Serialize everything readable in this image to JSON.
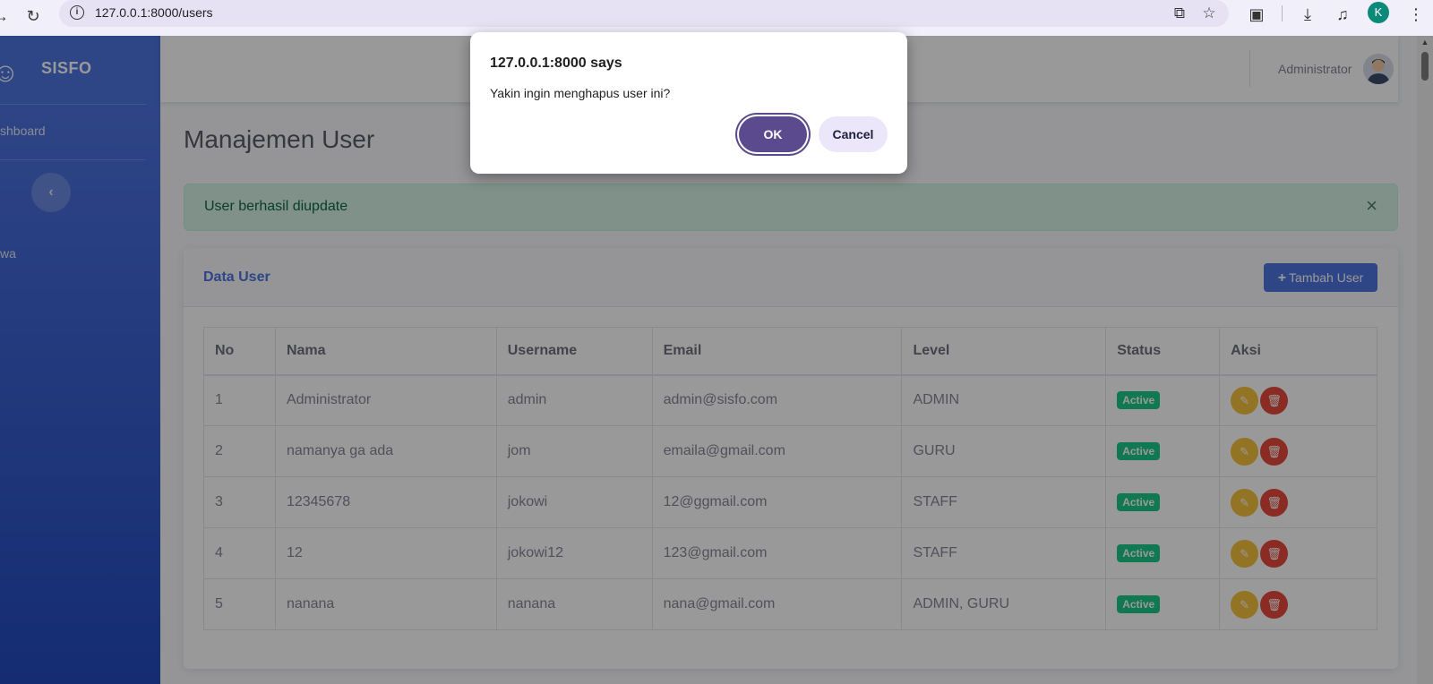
{
  "browser": {
    "url": "127.0.0.1:8000/users",
    "profile_initial": "K"
  },
  "sidebar": {
    "brand": "SISFO",
    "items": [
      {
        "label": "shboard"
      },
      {
        "label": "wa"
      }
    ]
  },
  "topbar": {
    "user_name": "Administrator"
  },
  "main": {
    "page_title": "Manajemen User",
    "alert_message": "User berhasil diupdate",
    "alert_close": "×",
    "card_title": "Data User",
    "add_button_label": "Tambah User",
    "table": {
      "headers": [
        "No",
        "Nama",
        "Username",
        "Email",
        "Level",
        "Status",
        "Aksi"
      ],
      "rows": [
        {
          "no": "1",
          "nama": "Administrator",
          "username": "admin",
          "email": "admin@sisfo.com",
          "level": "ADMIN",
          "status": "Active"
        },
        {
          "no": "2",
          "nama": "namanya ga ada",
          "username": "jom",
          "email": "emaila@gmail.com",
          "level": "GURU",
          "status": "Active"
        },
        {
          "no": "3",
          "nama": "12345678",
          "username": "jokowi",
          "email": "12@ggmail.com",
          "level": "STAFF",
          "status": "Active"
        },
        {
          "no": "4",
          "nama": "12",
          "username": "jokowi12",
          "email": "123@gmail.com",
          "level": "STAFF",
          "status": "Active"
        },
        {
          "no": "5",
          "nama": "nanana",
          "username": "nanana",
          "email": "nana@gmail.com",
          "level": "ADMIN, GURU",
          "status": "Active"
        }
      ]
    }
  },
  "dialog": {
    "title": "127.0.0.1:8000 says",
    "message": "Yakin ingin menghapus user ini?",
    "ok_label": "OK",
    "cancel_label": "Cancel"
  },
  "colors": {
    "primary": "#4e73df",
    "success": "#1cc88a",
    "warning": "#f6c23e",
    "danger": "#e74a3b",
    "dialog_ok": "#5c4a8e"
  }
}
